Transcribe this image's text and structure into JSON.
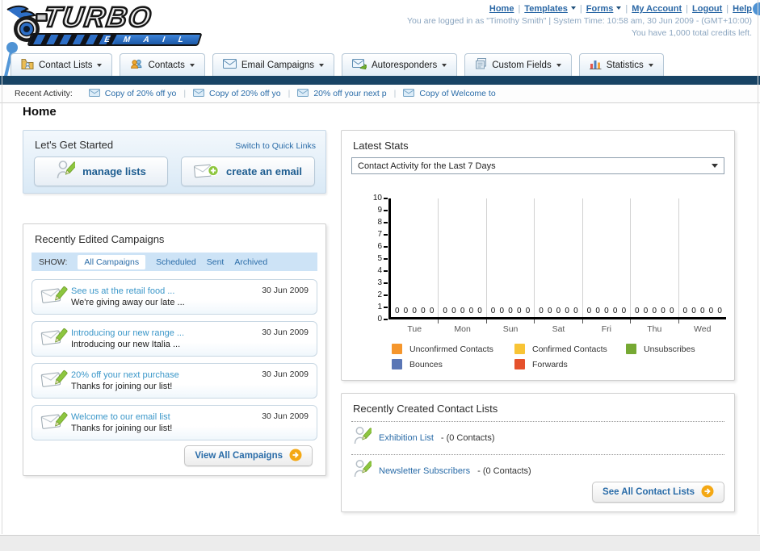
{
  "header": {
    "logo_line1": "TURBO",
    "logo_line2": "E M A I L",
    "nav_links": [
      {
        "label": "Home",
        "caret": false
      },
      {
        "label": "Templates",
        "caret": true
      },
      {
        "label": "Forms",
        "caret": true
      },
      {
        "label": "My Account",
        "caret": false
      },
      {
        "label": "Logout",
        "caret": false
      },
      {
        "label": "Help",
        "caret": false
      }
    ],
    "login_line": "You are logged in as \"Timothy Smith\" | System Time: 10:58 am, 30 Jun 2009 - (GMT+10:00)",
    "credits_line": "You have 1,000 total credits left."
  },
  "nav_tabs": [
    {
      "label": "Contact Lists",
      "icon": "folder-user-icon"
    },
    {
      "label": "Contacts",
      "icon": "users-icon"
    },
    {
      "label": "Email Campaigns",
      "icon": "envelope-icon"
    },
    {
      "label": "Autoresponders",
      "icon": "envelope-reply-icon"
    },
    {
      "label": "Custom Fields",
      "icon": "fields-icon"
    },
    {
      "label": "Statistics",
      "icon": "chart-icon"
    }
  ],
  "recent_activity": {
    "label": "Recent Activity:",
    "items": [
      {
        "label": "Copy of 20% off yo",
        "icon": "envelope-icon"
      },
      {
        "label": "Copy of 20% off yo",
        "icon": "envelope-icon"
      },
      {
        "label": "20% off your next p",
        "icon": "envelope-icon"
      },
      {
        "label": "Copy of Welcome to",
        "icon": "envelope-icon"
      }
    ]
  },
  "page_title": "Home",
  "get_started": {
    "title": "Let's Get Started",
    "switch_link": "Switch to Quick Links",
    "buttons": [
      {
        "label": "manage lists",
        "icon": "person-pencil-icon"
      },
      {
        "label": "create an email",
        "icon": "envelope-plus-icon"
      }
    ]
  },
  "campaigns": {
    "title": "Recently Edited Campaigns",
    "show_label": "SHOW:",
    "tabs": [
      "All Campaigns",
      "Scheduled",
      "Sent",
      "Archived"
    ],
    "selected_tab": "All Campaigns",
    "items": [
      {
        "title": "See us at the retail food ...",
        "subtitle": "We're giving away our late ...",
        "date": "30 Jun 2009"
      },
      {
        "title": "Introducing our new range ...",
        "subtitle": "Introducing our new Italia ...",
        "date": "30 Jun 2009"
      },
      {
        "title": "20% off your next purchase",
        "subtitle": "Thanks for joining our list!",
        "date": "30 Jun 2009"
      },
      {
        "title": "Welcome to our email list",
        "subtitle": "Thanks for joining our list!",
        "date": "30 Jun 2009"
      }
    ],
    "view_all_label": "View All Campaigns"
  },
  "stats": {
    "title": "Latest Stats",
    "dropdown_value": "Contact Activity for the Last 7 Days"
  },
  "chart_data": {
    "type": "bar",
    "title": "Contact Activity for the Last 7 Days",
    "categories": [
      "Tue",
      "Mon",
      "Sun",
      "Sat",
      "Fri",
      "Thu",
      "Wed"
    ],
    "series": [
      {
        "name": "Unconfirmed Contacts",
        "color": "#f5962c",
        "values": [
          0,
          0,
          0,
          0,
          0,
          0,
          0
        ]
      },
      {
        "name": "Confirmed Contacts",
        "color": "#f8c435",
        "values": [
          0,
          0,
          0,
          0,
          0,
          0,
          0
        ]
      },
      {
        "name": "Unsubscribes",
        "color": "#76a933",
        "values": [
          0,
          0,
          0,
          0,
          0,
          0,
          0
        ]
      },
      {
        "name": "Bounces",
        "color": "#5a76b5",
        "values": [
          0,
          0,
          0,
          0,
          0,
          0,
          0
        ]
      },
      {
        "name": "Forwards",
        "color": "#e5512c",
        "values": [
          0,
          0,
          0,
          0,
          0,
          0,
          0
        ]
      }
    ],
    "xlabel": "",
    "ylabel": "",
    "ylim": [
      0,
      10
    ],
    "ytick_step": 1,
    "grid": "vertical",
    "legend_position": "bottom"
  },
  "contact_lists": {
    "title": "Recently Created Contact Lists",
    "items": [
      {
        "name": "Exhibition List",
        "detail": "- (0 Contacts)",
        "icon": "person-pencil-icon"
      },
      {
        "name": "Newsletter Subscribers",
        "detail": "- (0 Contacts)",
        "icon": "person-pencil-icon"
      }
    ],
    "see_all_label": "See All Contact Lists"
  },
  "colors": {
    "navy_bar": "#184364",
    "link_blue": "#2a6ca8",
    "campaign_link": "#3b97c9",
    "panel_blue_bg": "#d9e9f6",
    "show_bar_bg": "#cde3f6",
    "annotation_blue": "#4f93d4",
    "button_arrow_orange": "#f4a814"
  }
}
